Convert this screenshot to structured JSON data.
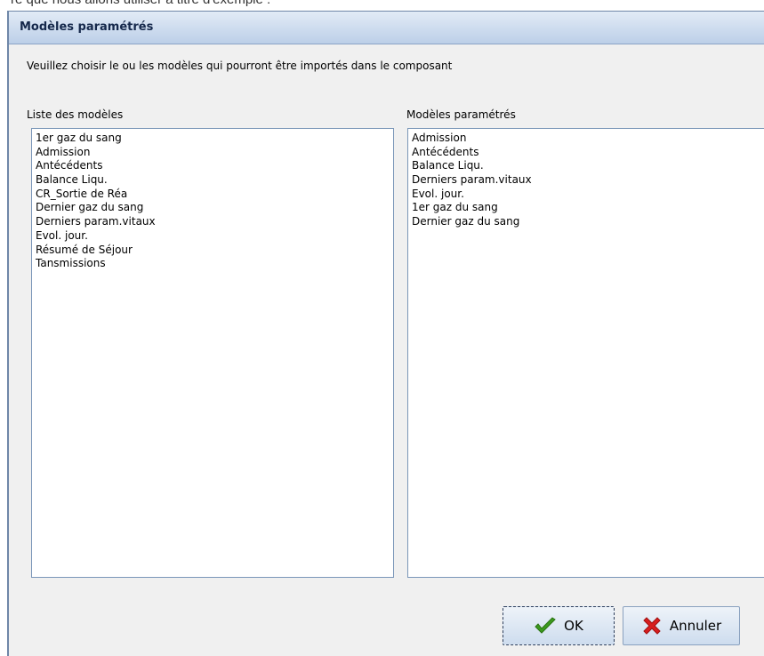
{
  "background_text": "re que nous allons utiliser à titre d'exemple :",
  "dialog": {
    "title": "Modèles paramétrés",
    "instructions": "Veuillez choisir le ou les modèles qui pourront être importés dans le composant",
    "left_list": {
      "label": "Liste des modèles",
      "items": [
        "1er gaz du sang",
        "Admission",
        "Antécédents",
        "Balance Liqu.",
        "CR_Sortie de Réa",
        "Dernier gaz du sang",
        "Derniers param.vitaux",
        "Evol. jour.",
        "Résumé de Séjour",
        "Tansmissions"
      ]
    },
    "right_list": {
      "label": "Modèles paramétrés",
      "items": [
        "Admission",
        "Antécédents",
        "Balance Liqu.",
        "Derniers param.vitaux",
        "Evol. jour.",
        "1er gaz du sang",
        "Dernier gaz du sang"
      ]
    },
    "buttons": {
      "ok_label": "OK",
      "cancel_label": "Annuler",
      "ok_icon": "checkmark-icon",
      "cancel_icon": "red-x-icon"
    }
  },
  "colors": {
    "titlebar_text": "#15284b",
    "checkmark": "#3c9a1e",
    "cancel_x": "#d81e1e"
  }
}
